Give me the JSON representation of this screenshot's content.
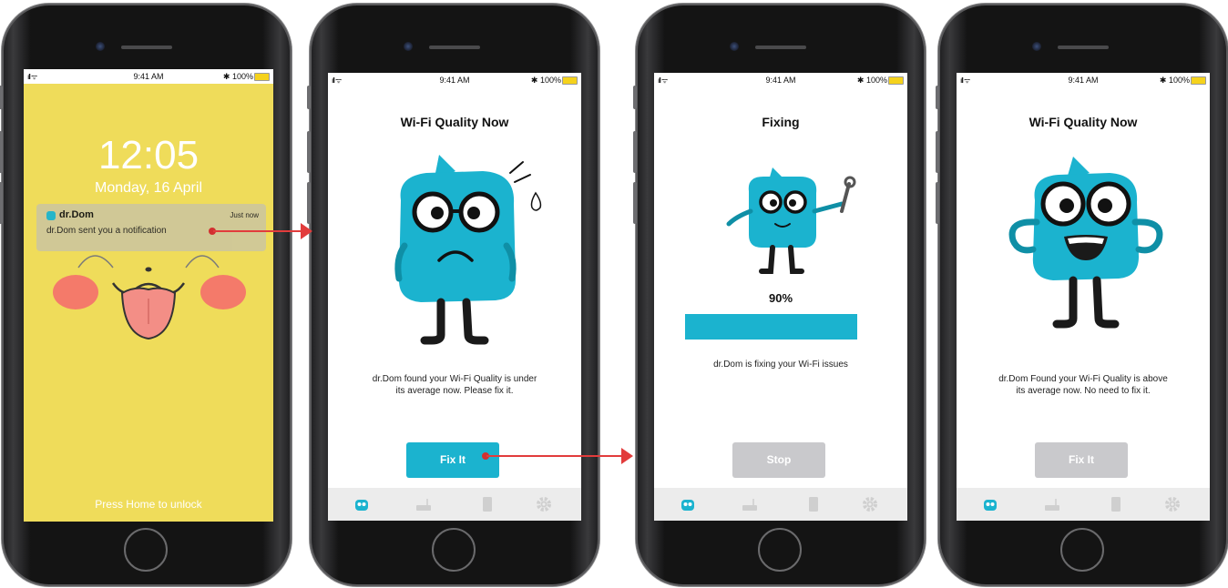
{
  "status_bar": {
    "time": "9:41 AM",
    "battery": "100%",
    "signal": "ıll ᯤ",
    "bluetooth": "✱"
  },
  "lock_screen": {
    "clock": "12:05",
    "date": "Monday, 16 April",
    "notification": {
      "app": "dr.Dom",
      "time": "Just now",
      "message": "dr.Dom sent you a notification"
    },
    "unlock_hint": "Press Home to unlock",
    "background": "#efdc5a"
  },
  "screen2": {
    "title": "Wi-Fi Quality Now",
    "description_line1": "dr.Dom found your Wi-Fi Quality is under",
    "description_line2": "its average now. Please fix it.",
    "button": "Fix It"
  },
  "screen3": {
    "title": "Fixing",
    "progress_text": "90%",
    "progress_value": 0.9,
    "description": "dr.Dom is fixing your Wi-Fi issues",
    "button": "Stop"
  },
  "screen4": {
    "title": "Wi-Fi Quality Now",
    "description_line1": "dr.Dom Found your Wi-Fi Quality is above",
    "description_line2": "its average now. No need to fix it.",
    "button": "Fix It"
  },
  "tabs": [
    "dr-dom-icon",
    "router-icon",
    "phone-icon",
    "settings-icon"
  ],
  "colors": {
    "accent": "#1bb3cf",
    "disabled": "#c9c9cc",
    "arrow": "#e23c3c",
    "mascot": "#22b3cc"
  }
}
